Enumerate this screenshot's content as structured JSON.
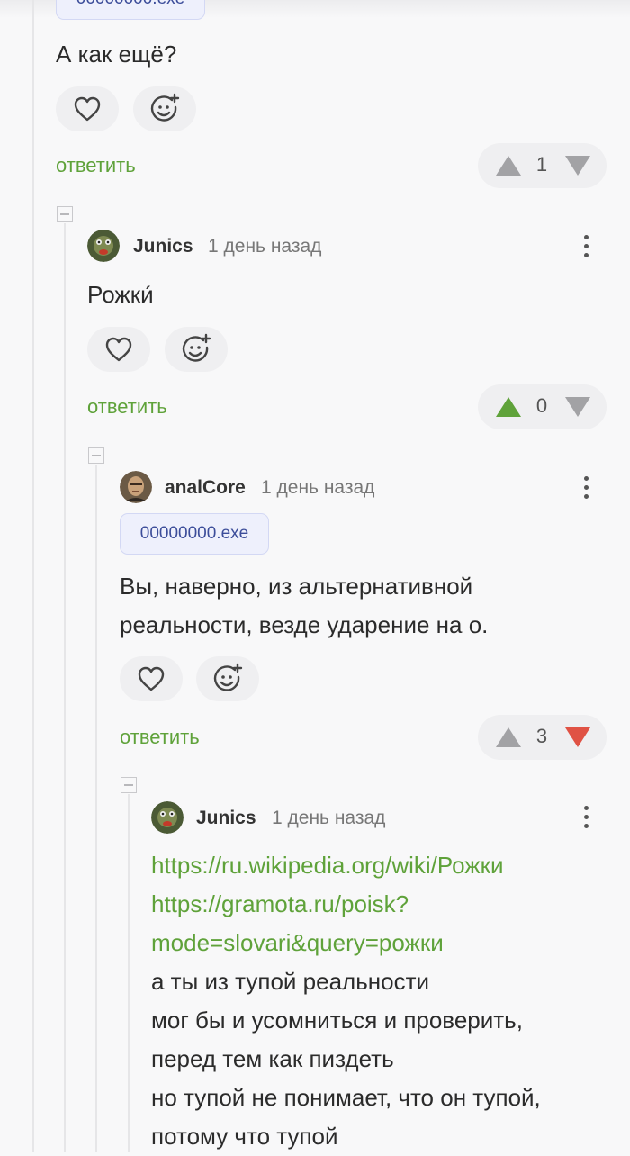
{
  "colors": {
    "accent_green": "#5fa23a",
    "downvote_red": "#e05244",
    "upvote_green": "#5fa23a",
    "neutral_arrow": "#a2a2a5"
  },
  "comments": [
    {
      "tag": "00000000.exe",
      "text": "А как ещё?",
      "reply_label": "ответить",
      "rating": "1",
      "like_icon": "heart-icon",
      "reaction_icon": "smiley-add-icon"
    },
    {
      "author": "Junics",
      "time": "1 день назад",
      "text": "Рожки́",
      "reply_label": "ответить",
      "rating": "0",
      "upvoted": true
    },
    {
      "author": "analCore",
      "time": "1 день назад",
      "tag": "00000000.exe",
      "text_lines": [
        "Вы, наверно, из альтернативной",
        "реальности, везде ударение на о."
      ],
      "reply_label": "ответить",
      "rating": "3",
      "downvoted": true
    },
    {
      "author": "Junics",
      "time": "1 день назад",
      "links": [
        "https://ru.wikipedia.org/wiki/Рожки",
        "https://gramota.ru/poisk?",
        "mode=slovari&query=рожки"
      ],
      "text_lines": [
        "а ты из тупой реальности",
        "мог бы и усомниться и проверить,",
        "перед тем как пиздеть",
        "но тупой не понимает, что он тупой,",
        "потому что тупой"
      ]
    }
  ]
}
